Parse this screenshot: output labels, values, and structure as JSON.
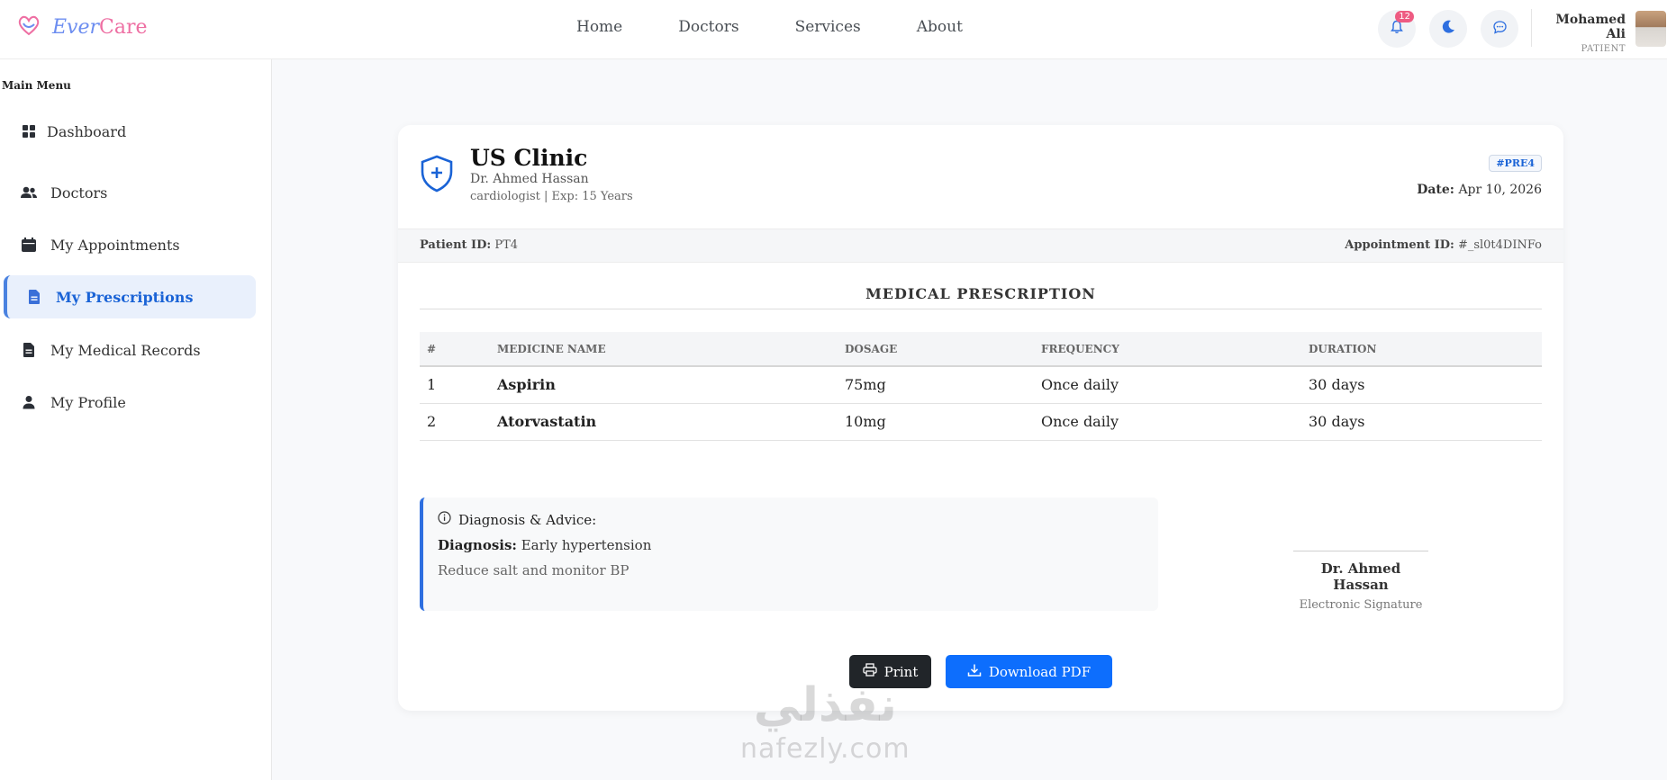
{
  "brand": {
    "part1": "Ever",
    "part2": "Care"
  },
  "nav": {
    "links": [
      "Home",
      "Doctors",
      "Services",
      "About"
    ]
  },
  "notifications": {
    "count": "12"
  },
  "user": {
    "name": "Mohamed Ali",
    "role": "PATIENT"
  },
  "sidebar": {
    "title": "Main Menu",
    "items": [
      {
        "label": "Dashboard",
        "icon": "grid-icon"
      },
      {
        "label": "Doctors",
        "icon": "users-icon"
      },
      {
        "label": "My Appointments",
        "icon": "calendar-icon"
      },
      {
        "label": "My Prescriptions",
        "icon": "prescription-icon",
        "active": true
      },
      {
        "label": "My Medical Records",
        "icon": "file-icon"
      },
      {
        "label": "My Profile",
        "icon": "user-icon"
      }
    ]
  },
  "prescription": {
    "clinic": "US Clinic",
    "doctor": "Dr. Ahmed Hassan",
    "meta": "cardiologist | Exp: 15 Years",
    "id": "#PRE4",
    "date_label": "Date:",
    "date": "Apr 10, 2026",
    "patient_label": "Patient ID:",
    "patient_id": "PT4",
    "appointment_label": "Appointment ID:",
    "appointment_id": "#_sl0t4DINFo",
    "section_title": "MEDICAL PRESCRIPTION",
    "columns": [
      "#",
      "MEDICINE NAME",
      "DOSAGE",
      "FREQUENCY",
      "DURATION"
    ],
    "rows": [
      {
        "n": "1",
        "name": "Aspirin",
        "dosage": "75mg",
        "frequency": "Once daily",
        "duration": "30 days"
      },
      {
        "n": "2",
        "name": "Atorvastatin",
        "dosage": "10mg",
        "frequency": "Once daily",
        "duration": "30 days"
      }
    ],
    "advice_title": "Diagnosis & Advice:",
    "diagnosis_label": "Diagnosis:",
    "diagnosis": "Early hypertension",
    "advice": "Reduce salt and monitor BP",
    "signature_name": "Dr. Ahmed Hassan",
    "signature_label": "Electronic Signature"
  },
  "actions": {
    "print": "Print",
    "download": "Download PDF"
  },
  "watermark": {
    "arabic": "نفذلي",
    "latin": "nafezly.com"
  },
  "colors": {
    "primary": "#0d6efd",
    "brand_blue": "#6c8df0",
    "brand_pink": "#ee6fa3",
    "dark": "#212529"
  }
}
